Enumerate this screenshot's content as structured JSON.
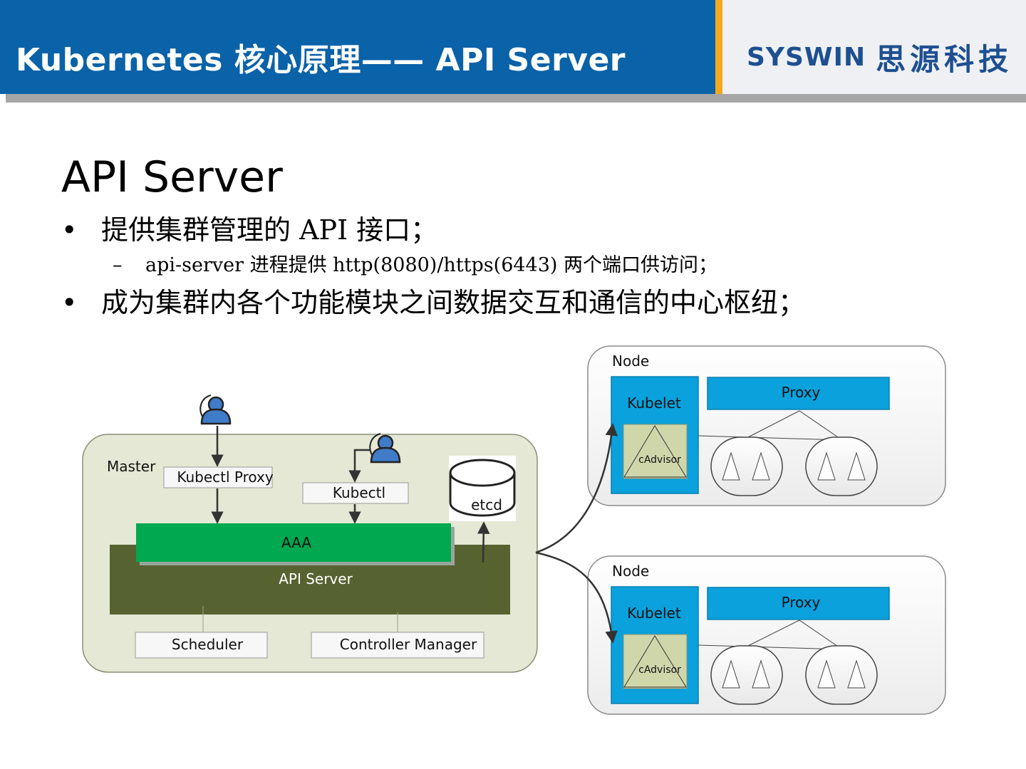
{
  "header": {
    "title": "Kubernetes 核心原理—— API Server",
    "logo_en": "SYSWIN",
    "logo_cn": "思源科技",
    "colors": {
      "bar": "#0a62a8",
      "accent": "#f4a81d",
      "logo": "#1d4f91"
    }
  },
  "content": {
    "heading": "API Server",
    "bullets": [
      {
        "marker": "•",
        "text": "提供集群管理的 API 接口；"
      },
      {
        "marker": "–",
        "text": "api-server 进程提供 http(8080)/https(6443) 两个端口供访问；"
      },
      {
        "marker": "•",
        "text": "成为集群内各个功能模块之间数据交互和通信的中心枢纽；"
      }
    ]
  },
  "diagram": {
    "master": {
      "label": "Master",
      "kubectl_proxy": "Kubectl Proxy",
      "kubectl": "Kubectl",
      "etcd": "etcd",
      "aaa": "AAA",
      "api_server": "API Server",
      "scheduler": "Scheduler",
      "controller_manager": "Controller Manager",
      "user_icons": [
        "user-icon",
        "user-icon"
      ]
    },
    "nodes": [
      {
        "label": "Node",
        "kubelet": "Kubelet",
        "proxy": "Proxy",
        "cadvisor": "cAdvisor"
      },
      {
        "label": "Node",
        "kubelet": "Kubelet",
        "proxy": "Proxy",
        "cadvisor": "cAdvisor"
      }
    ],
    "colors": {
      "aaa": "#00a84f",
      "api_server": "#566331",
      "kubelet": "#0aa1dd",
      "proxy": "#0aa1dd",
      "master_bg": "#e4e8d4",
      "cadvisor": "#cfd6aa"
    }
  }
}
